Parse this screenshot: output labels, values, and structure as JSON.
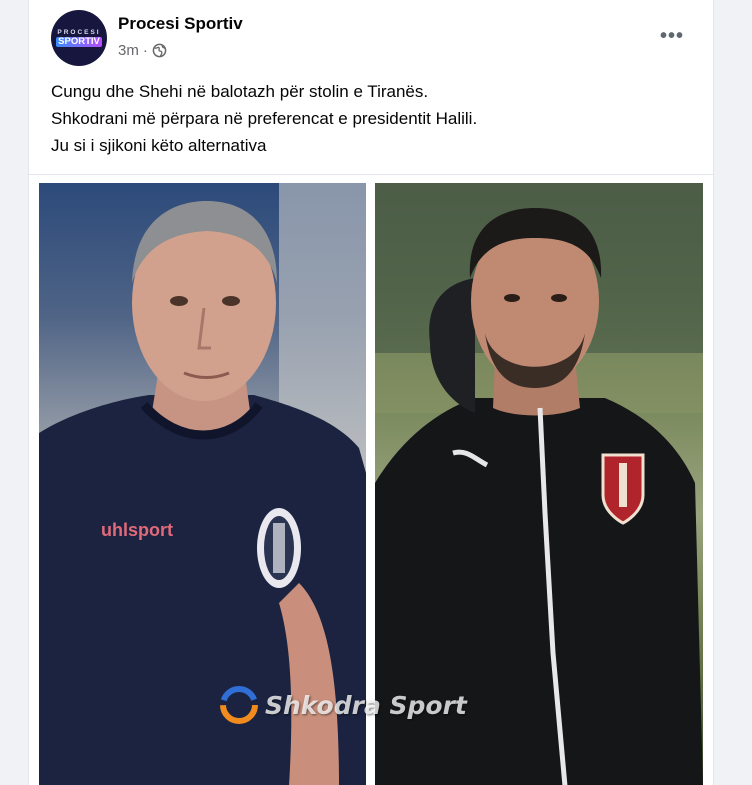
{
  "post": {
    "author": "Procesi Sportiv",
    "avatar": {
      "line1": "PROCESI",
      "line2": "SPORTIV"
    },
    "timestamp": "3m",
    "dot": "·",
    "privacy_icon": "globe-icon",
    "more_label": "•••",
    "text_lines": [
      "Cungu dhe Shehi në balotazh për stolin e Tiranës.",
      "Shkodrani më përpara në preferencat e presidentit Halili.",
      "Ju si i sjikoni këto alternativa"
    ],
    "photos": {
      "left": {
        "shirt_brand": "uhlsport"
      },
      "right": {}
    },
    "watermark": "Shkodra Sport"
  },
  "colors": {
    "page_bg": "#f0f2f5",
    "card_bg": "#ffffff",
    "author": "#050505",
    "meta": "#65676b",
    "avatar_bg": "#16163f"
  }
}
